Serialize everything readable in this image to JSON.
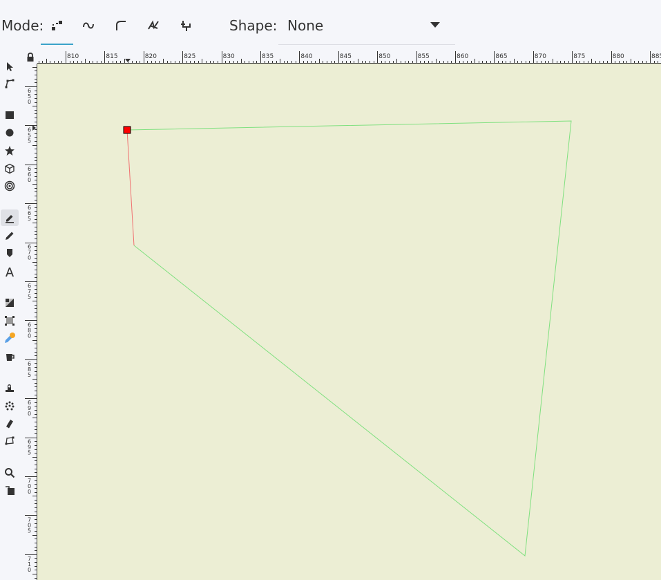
{
  "toolbar": {
    "mode_label": "Mode:",
    "mode_buttons": [
      {
        "name": "regular-bezier-mode-icon"
      },
      {
        "name": "spiro-mode-icon"
      },
      {
        "name": "bspline-mode-icon"
      },
      {
        "name": "zigzag-mode-icon"
      },
      {
        "name": "paraxial-mode-icon"
      }
    ],
    "shape_label": "Shape:",
    "shape_value": "None"
  },
  "ruler": {
    "h_labels": [
      "810",
      "815",
      "820",
      "825",
      "830",
      "835",
      "840",
      "845",
      "850",
      "855",
      "860",
      "865",
      "870",
      "875",
      "880",
      "885"
    ],
    "v_labels": [
      "650",
      "655",
      "660",
      "665",
      "670",
      "675",
      "680",
      "685",
      "690",
      "695",
      "700",
      "705",
      "710"
    ]
  },
  "toolbox": {
    "tools": [
      "selector-icon",
      "node-icon",
      "rectangle-icon",
      "ellipse-icon",
      "star-icon",
      "box3d-icon",
      "spiral-icon",
      "pen-icon",
      "pencil-icon",
      "calligraphy-icon",
      "text-icon",
      "gradient-icon",
      "mesh-icon",
      "dropper-icon",
      "paint-bucket-icon",
      "tweak-icon",
      "spray-icon",
      "eraser-icon",
      "connector-icon",
      "zoom-icon",
      "measure-icon"
    ],
    "active_tool": "pen-icon"
  },
  "colors": {
    "canvas": "#eceed4",
    "path_stroke": "#7fe07f",
    "active_segment": "#f07070",
    "node_fill": "#ff0000",
    "accent": "#3aa3c9"
  }
}
